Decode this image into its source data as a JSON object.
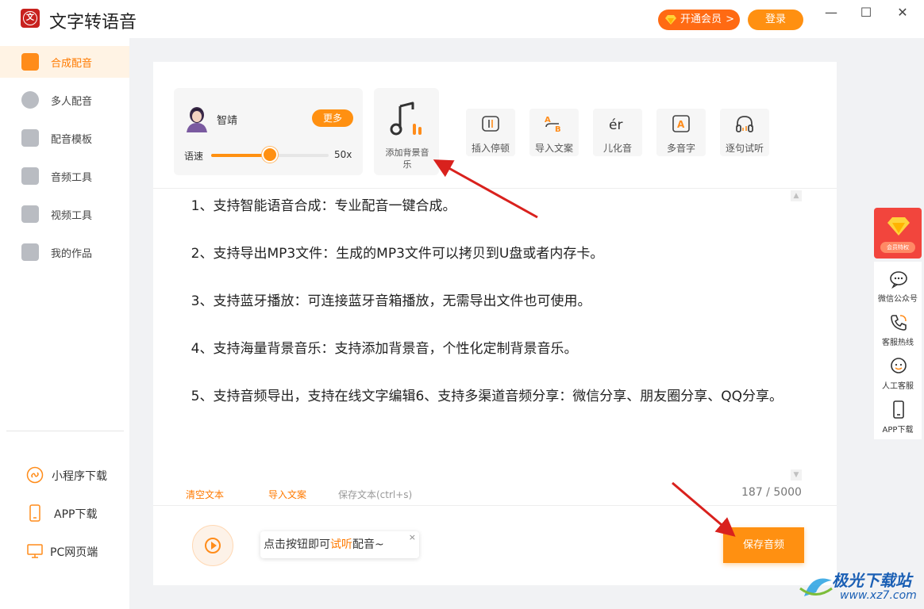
{
  "app": {
    "title": "文字转语音",
    "vip_label": "开通会员",
    "vip_arrow": ">",
    "login_label": "登录",
    "window_controls": {
      "minimize": "—",
      "maximize": "☐",
      "close": "✕"
    }
  },
  "sidebar": {
    "items": [
      {
        "label": "合成配音",
        "icon": "microphone-icon",
        "active": true
      },
      {
        "label": "多人配音",
        "icon": "users-icon",
        "active": false
      },
      {
        "label": "配音模板",
        "icon": "template-icon",
        "active": false
      },
      {
        "label": "音频工具",
        "icon": "music-file-icon",
        "active": false
      },
      {
        "label": "视频工具",
        "icon": "video-icon",
        "active": false
      },
      {
        "label": "我的作品",
        "icon": "folder-icon",
        "active": false
      }
    ],
    "footer": [
      {
        "label": "小程序下载",
        "icon": "mini-program-icon"
      },
      {
        "label": "APP下载",
        "icon": "phone-icon"
      },
      {
        "label": "PC网页端",
        "icon": "monitor-icon"
      }
    ]
  },
  "voice": {
    "name": "智靖",
    "more_label": "更多",
    "speed_label": "语速",
    "speed_value": "50x",
    "speed_level": 0.5
  },
  "bgm": {
    "label": "添加背景音乐"
  },
  "tools": [
    {
      "label": "插入停顿",
      "icon": "pause-insert-icon"
    },
    {
      "label": "导入文案",
      "icon": "import-text-icon"
    },
    {
      "label": "儿化音",
      "icon": "er-sound-icon",
      "glyph": "ér"
    },
    {
      "label": "多音字",
      "icon": "polyphone-icon",
      "glyph": "A"
    },
    {
      "label": "逐句试听",
      "icon": "headphones-icon"
    }
  ],
  "content": {
    "paragraphs": [
      "    1、支持智能语音合成：专业配音一键合成。",
      "    2、支持导出MP3文件：生成的MP3文件可以拷贝到U盘或者内存卡。",
      "    3、支持蓝牙播放：可连接蓝牙音箱播放，无需导出文件也可使用。",
      "    4、支持海量背景音乐：支持添加背景音，个性化定制背景音乐。",
      "    5、支持音频导出，支持在线文字编辑6、支持多渠道音频分享：微信分享、朋友圈分享、QQ分享。"
    ]
  },
  "editor_footer": {
    "clear_label": "清空文本",
    "import_label": "导入文案",
    "save_text_label": "保存文本(ctrl+s)",
    "char_count": "187 / 5000"
  },
  "player": {
    "hint_prefix": "点击按钮即可",
    "hint_highlight": "试听",
    "hint_suffix": "配音~",
    "hint_close": "×",
    "save_audio_label": "保存音频"
  },
  "right_bar": {
    "vip_tag": "会员特权",
    "items": [
      {
        "label": "微信公众号",
        "icon": "wechat-icon"
      },
      {
        "label": "客服热线",
        "icon": "phone-call-icon"
      },
      {
        "label": "人工客服",
        "icon": "service-icon"
      },
      {
        "label": "APP下载",
        "icon": "mobile-icon"
      }
    ]
  },
  "watermark": {
    "title": "极光下载站",
    "url": "www.xz7.com"
  },
  "colors": {
    "accent": "#ff9011",
    "vip": "#ff6a13",
    "arrow": "#d9211d",
    "watermark": "#1a5fb4"
  }
}
